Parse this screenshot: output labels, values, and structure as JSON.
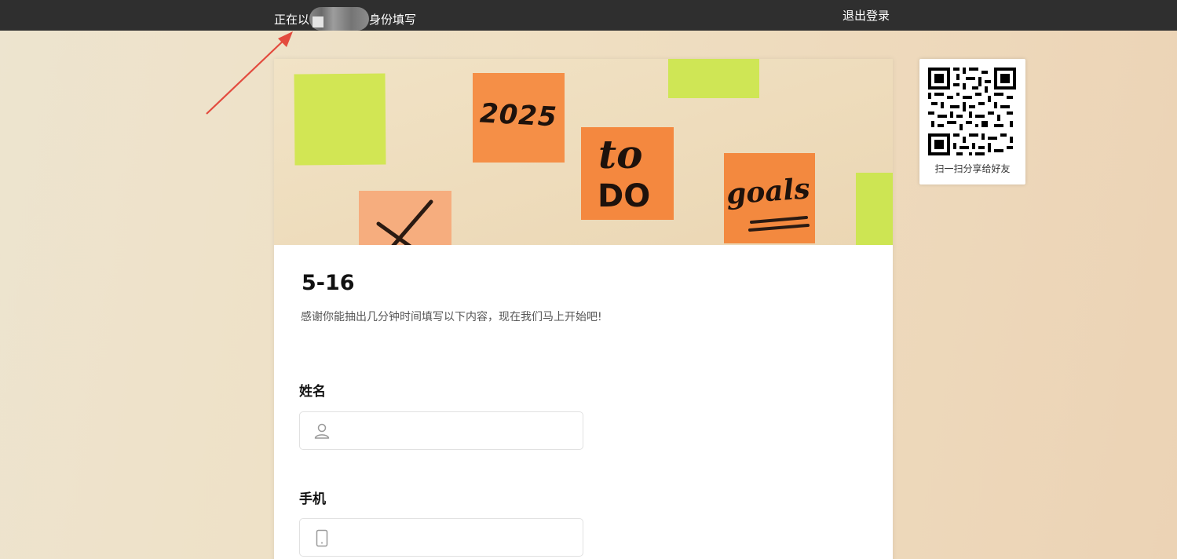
{
  "topbar": {
    "identity_prefix": "正在以",
    "identity_suffix": "身份填写",
    "logout_label": "退出登录"
  },
  "banner": {
    "notes": [
      "2025",
      "to",
      "DO",
      "goals"
    ]
  },
  "form": {
    "title": "5-16",
    "description": "感谢你能抽出几分钟时间填写以下内容，现在我们马上开始吧!",
    "fields": [
      {
        "label": "姓名",
        "icon": "user-icon",
        "value": ""
      },
      {
        "label": "手机",
        "icon": "phone-icon",
        "value": ""
      }
    ]
  },
  "qr": {
    "caption": "扫一扫分享给好友"
  },
  "colors": {
    "topbar": "#2f2f2f",
    "annotation_arrow": "#e34b3e",
    "note_green": "#cfe653",
    "note_orange": "#f58c45"
  }
}
